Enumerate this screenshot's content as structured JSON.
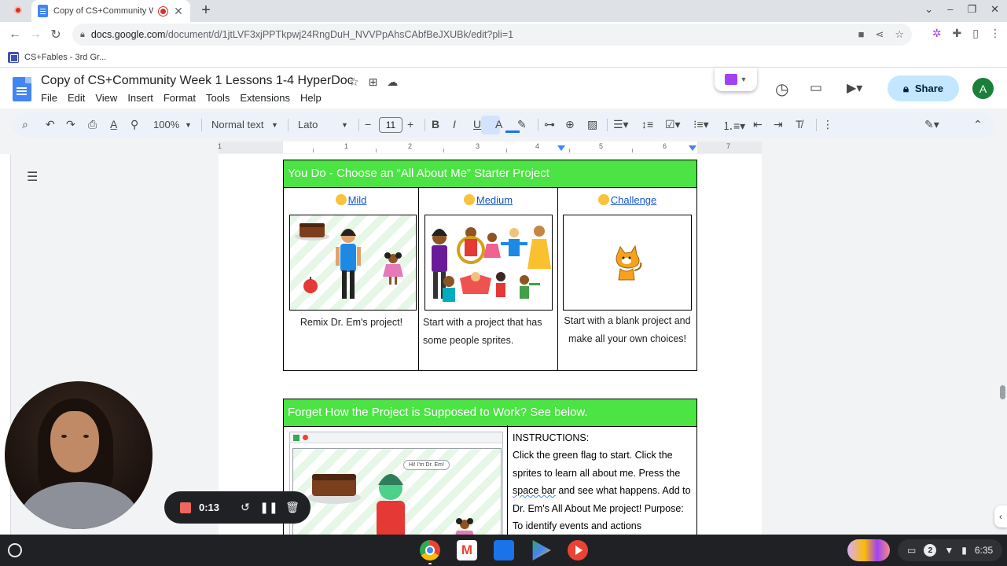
{
  "browser": {
    "tab_title": "Copy of CS+Community We",
    "tab_close": "✕",
    "new_tab": "+",
    "url_host": "docs.google.com",
    "url_path": "/document/d/1jtLVF3xjPPTkpwj24RngDuH_NVVPpAhsCAbfBeJXUBk/edit?pli=1",
    "bookmark_label": "CS+Fables - 3rd Gr..."
  },
  "docs": {
    "title": "Copy of CS+Community Week 1 Lessons 1-4  HyperDoc",
    "menu": [
      "File",
      "Edit",
      "View",
      "Insert",
      "Format",
      "Tools",
      "Extensions",
      "Help"
    ],
    "share_label": "Share",
    "avatar_letter": "A",
    "toolbar": {
      "zoom": "100%",
      "style": "Normal text",
      "font": "Lato",
      "font_size": "11"
    },
    "ruler_numbers": [
      "1",
      "1",
      "2",
      "3",
      "4",
      "5",
      "6",
      "7"
    ]
  },
  "table1": {
    "header": "You Do - Choose an “All About Me” Starter Project",
    "columns": [
      {
        "title": "Mild",
        "text": "Remix Dr. Em's project!"
      },
      {
        "title": "Medium",
        "text": "Start with a project that has some people sprites."
      },
      {
        "title": "Challenge",
        "text": "Start with a blank project and make all your own choices!"
      }
    ]
  },
  "table2": {
    "header": "Forget How the Project is Supposed to Work? See below.",
    "speech_bubble": "Hi! I'm Dr. Em!",
    "instructions_title": "INSTRUCTIONS:",
    "instructions_before": "Click the green flag to start. Click the sprites to learn all about me. Press the ",
    "instructions_squiggle": "space bar",
    "instructions_after": " and see what happens. Add to Dr. Em's All About Me project! Purpose: To identify events and actions"
  },
  "recorder": {
    "time": "0:13"
  },
  "shelf": {
    "notification_count": "2",
    "clock": "6:35"
  },
  "colors": {
    "header_green": "#4ce344",
    "link_blue": "#1155cc",
    "share_bg": "#c2e7ff"
  }
}
